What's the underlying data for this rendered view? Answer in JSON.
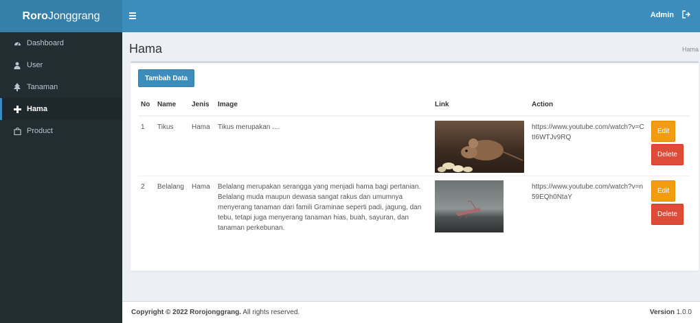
{
  "brand": {
    "bold": "Roro",
    "rest": "Jonggrang"
  },
  "topbar": {
    "user": "Admin"
  },
  "sidebar": {
    "items": [
      {
        "label": "Dashboard",
        "icon": "dashboard-icon"
      },
      {
        "label": "User",
        "icon": "user-icon"
      },
      {
        "label": "Tanaman",
        "icon": "tree-icon"
      },
      {
        "label": "Hama",
        "icon": "plus-icon",
        "active": true
      },
      {
        "label": "Product",
        "icon": "bag-icon"
      }
    ]
  },
  "page": {
    "title": "Hama",
    "breadcrumb": "Hama"
  },
  "actions": {
    "add_label": "Tambah Data"
  },
  "table": {
    "headers": [
      "No",
      "Name",
      "Jenis",
      "Image",
      "Link",
      "Action"
    ],
    "rows": [
      {
        "no": "1",
        "name": "Tikus",
        "jenis": "Hama",
        "desc": "Tikus merupakan ....",
        "image": "mouse-photo",
        "link": "https://www.youtube.com/watch?v=CtI6WTJv9RQ",
        "edit": "Edit",
        "delete": "Delete"
      },
      {
        "no": "2",
        "name": "Belalang",
        "jenis": "Hama",
        "desc": "Belalang merupakan serangga yang menjadi hama bagi pertanian. Belalang muda maupun dewasa sangat rakus dan umumnya menyerang tanaman dari famili Graminae seperti padi, jagung, dan tebu, tetapi juga menyerang tanaman hias, buah, sayuran, dan tanaman perkebunan.",
        "image": "grasshopper-photo",
        "link": "https://www.youtube.com/watch?v=n59EQh0NtaY",
        "edit": "Edit",
        "delete": "Delete"
      }
    ]
  },
  "footer": {
    "copyright_prefix": "Copyright © 2022 Rorojonggrang.",
    "copyright_suffix": " All rights reserved.",
    "version_label": "Version",
    "version_value": " 1.0.0"
  },
  "colors": {
    "header": "#3c8dbc",
    "brand_bg": "#367fa9",
    "sidebar": "#222d32",
    "edit": "#f39c12",
    "delete": "#dd4b39"
  }
}
